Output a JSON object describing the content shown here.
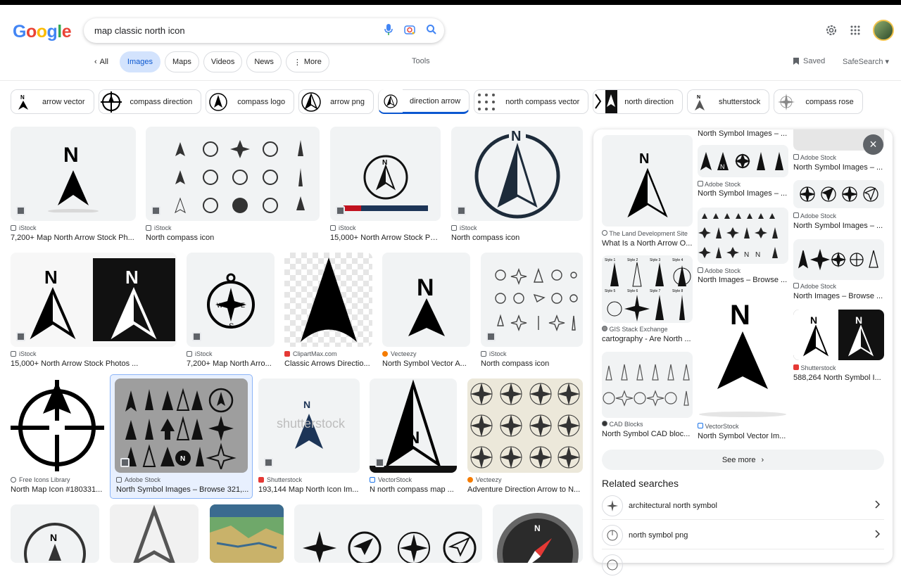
{
  "logo": [
    "G",
    "o",
    "o",
    "g",
    "l",
    "e"
  ],
  "logo_colors": [
    "#4285f4",
    "#ea4335",
    "#fbbc05",
    "#4285f4",
    "#34a853",
    "#ea4335"
  ],
  "search": {
    "query": "map classic north icon"
  },
  "nav": {
    "all": "All",
    "images": "Images",
    "maps": "Maps",
    "videos": "Videos",
    "news": "News",
    "more": "More",
    "tools": "Tools",
    "saved": "Saved",
    "safesearch": "SafeSearch"
  },
  "related_chips": [
    "arrow vector",
    "compass direction",
    "compass logo",
    "arrow png",
    "direction arrow",
    "north compass vector",
    "north direction",
    "shutterstock",
    "compass rose"
  ],
  "results": [
    {
      "source": "iStock",
      "title": "7,200+ Map North Arrow Stock Ph..."
    },
    {
      "source": "iStock",
      "title": "North compass icon"
    },
    {
      "source": "iStock",
      "title": "15,000+ North Arrow Stock Ph..."
    },
    {
      "source": "iStock",
      "title": "North compass icon"
    },
    {
      "source": "iStock",
      "title": "15,000+ North Arrow Stock Photos ..."
    },
    {
      "source": "iStock",
      "title": "7,200+ Map North Arro..."
    },
    {
      "source": "ClipartMax.com",
      "title": "Classic Arrows Directio..."
    },
    {
      "source": "Vecteezy",
      "title": "North Symbol Vector A..."
    },
    {
      "source": "iStock",
      "title": "North compass icon"
    },
    {
      "source": "Free Icons Library",
      "title": "North Map Icon #180331..."
    },
    {
      "source": "Adobe Stock",
      "title": "North Symbol Images – Browse 321,..."
    },
    {
      "source": "Shutterstock",
      "title": "193,144 Map North Icon Im..."
    },
    {
      "source": "VectorStock",
      "title": "N north compass map ..."
    },
    {
      "source": "Vecteezy",
      "title": "Adventure Direction Arrow to N..."
    }
  ],
  "panel": {
    "items": [
      {
        "source": "The Land Development Site",
        "title": "What Is a North Arrow O..."
      },
      {
        "source": "GIS Stack Exchange",
        "title": "cartography - Are North ..."
      },
      {
        "source": "CAD Blocks",
        "title": "North Symbol CAD bloc..."
      },
      {
        "source": "",
        "title": "North Symbol Images – ..."
      },
      {
        "source": "Adobe Stock",
        "title": "North Symbol Images – ..."
      },
      {
        "source": "Adobe Stock",
        "title": "North Images – Browse ..."
      },
      {
        "source": "VectorStock",
        "title": "North Symbol Vector Im..."
      },
      {
        "source": "Adobe Stock",
        "title": "North Symbol Images – ..."
      },
      {
        "source": "Adobe Stock",
        "title": "North Symbol Images – ..."
      },
      {
        "source": "Adobe Stock",
        "title": "North Images – Browse ..."
      },
      {
        "source": "Shutterstock",
        "title": "588,264 North Symbol I..."
      }
    ],
    "see_more": "See more",
    "related_title": "Related searches",
    "related": [
      "architectural north symbol",
      "north symbol png"
    ]
  }
}
